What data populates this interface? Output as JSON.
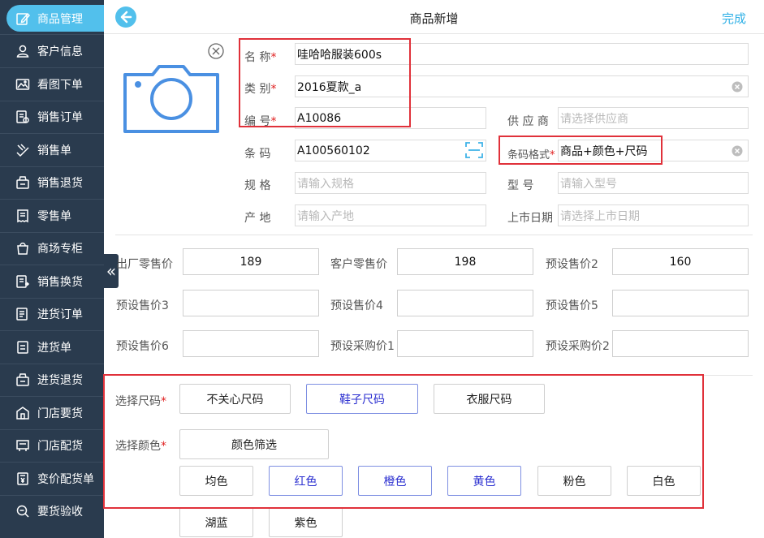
{
  "sidebar": {
    "items": [
      {
        "label": "商品管理",
        "icon": "edit-icon",
        "active": true
      },
      {
        "label": "客户信息",
        "icon": "user-icon"
      },
      {
        "label": "看图下单",
        "icon": "image-icon"
      },
      {
        "label": "销售订单",
        "icon": "order-icon"
      },
      {
        "label": "销售单",
        "icon": "sale-icon"
      },
      {
        "label": "销售退货",
        "icon": "return-icon"
      },
      {
        "label": "零售单",
        "icon": "receipt-icon"
      },
      {
        "label": "商场专柜",
        "icon": "bag-icon"
      },
      {
        "label": "销售换货",
        "icon": "exchange-icon"
      },
      {
        "label": "进货订单",
        "icon": "purchase-order-icon"
      },
      {
        "label": "进货单",
        "icon": "purchase-icon"
      },
      {
        "label": "进货退货",
        "icon": "purchase-return-icon"
      },
      {
        "label": "门店要货",
        "icon": "store-icon"
      },
      {
        "label": "门店配货",
        "icon": "distribution-icon"
      },
      {
        "label": "变价配货单",
        "icon": "price-change-icon"
      },
      {
        "label": "要货验收",
        "icon": "inspect-icon"
      }
    ]
  },
  "header": {
    "title": "商品新增",
    "done_label": "完成"
  },
  "form": {
    "name": {
      "label": "名  称",
      "value": "哇哈哈服装600s"
    },
    "category": {
      "label": "类  别",
      "value": "2016夏款_a"
    },
    "code": {
      "label": "编  号",
      "value": "A10086"
    },
    "supplier": {
      "label": "供 应 商",
      "placeholder": "请选择供应商"
    },
    "barcode": {
      "label": "条  码",
      "value": "A100560102"
    },
    "barcode_format": {
      "label": "条码格式",
      "value": "商品+颜色+尺码"
    },
    "spec": {
      "label": "规  格",
      "placeholder": "请输入规格"
    },
    "model": {
      "label": "型   号",
      "placeholder": "请输入型号"
    },
    "origin": {
      "label": "产  地",
      "placeholder": "请输入产地"
    },
    "launch_date": {
      "label": "上市日期",
      "placeholder": "请选择上市日期"
    }
  },
  "prices": [
    {
      "label": "出厂零售价",
      "value": "189"
    },
    {
      "label": "客户零售价",
      "value": "198"
    },
    {
      "label": "预设售价2",
      "value": "160"
    },
    {
      "label": "预设售价3",
      "value": ""
    },
    {
      "label": "预设售价4",
      "value": ""
    },
    {
      "label": "预设售价5",
      "value": ""
    },
    {
      "label": "预设售价6",
      "value": ""
    },
    {
      "label": "预设采购价1",
      "value": ""
    },
    {
      "label": "预设采购价2",
      "value": ""
    }
  ],
  "size": {
    "label": "选择尺码",
    "options": [
      {
        "label": "不关心尺码",
        "selected": false
      },
      {
        "label": "鞋子尺码",
        "selected": true
      },
      {
        "label": "衣服尺码",
        "selected": false
      }
    ]
  },
  "color": {
    "label": "选择颜色",
    "filter_label": "颜色筛选",
    "options": [
      {
        "label": "均色",
        "selected": false
      },
      {
        "label": "红色",
        "selected": true
      },
      {
        "label": "橙色",
        "selected": true
      },
      {
        "label": "黄色",
        "selected": true
      },
      {
        "label": "粉色",
        "selected": false
      },
      {
        "label": "白色",
        "selected": false
      },
      {
        "label": "湖蓝",
        "selected": false
      },
      {
        "label": "紫色",
        "selected": false
      }
    ]
  },
  "colors": {
    "accent": "#52c0ec",
    "sidebar_bg": "#2a3b4e",
    "highlight": "#e0313a",
    "selected_text": "#2b2fd0"
  }
}
